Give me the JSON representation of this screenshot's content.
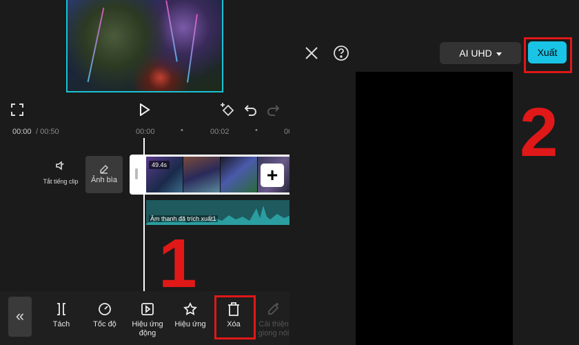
{
  "editor": {
    "time_current": "00:00",
    "time_total": "/ 00:50",
    "ruler": [
      "00:00",
      "00:02",
      "00"
    ],
    "clip_duration": "49.4s",
    "mute_label": "Tắt tiếng clip",
    "cover_label": "Ảnh bìa",
    "audio_label": "Âm thanh đã trích xuất1",
    "annotation": "1",
    "tools": [
      {
        "label": "Tách",
        "icon": "split-icon"
      },
      {
        "label": "Tốc độ",
        "icon": "speed-icon"
      },
      {
        "label": "Hiệu ứng động",
        "icon": "animation-icon"
      },
      {
        "label": "Hiệu ứng",
        "icon": "effects-icon"
      },
      {
        "label": "Xóa",
        "icon": "trash-icon"
      },
      {
        "label": "Cải thiện giọng nói",
        "icon": "voice-enhance-icon"
      }
    ]
  },
  "export_screen": {
    "quality_label": "AI UHD",
    "export_label": "Xuất",
    "annotation": "2"
  },
  "colors": {
    "accent": "#19c4e6",
    "highlight": "#e01818",
    "background": "#1b1b1b"
  }
}
